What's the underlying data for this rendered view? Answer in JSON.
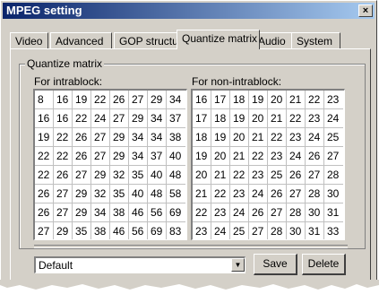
{
  "window": {
    "title": "MPEG setting",
    "close_label": "×"
  },
  "tabs": [
    {
      "label": "Video"
    },
    {
      "label": "Advanced"
    },
    {
      "label": "GOP structure"
    },
    {
      "label": "Quantize matrix",
      "active": true
    },
    {
      "label": "Audio"
    },
    {
      "label": "System"
    }
  ],
  "group": {
    "label": "Quantize matrix"
  },
  "intra": {
    "label": "For intrablock:",
    "rows": [
      [
        "8",
        "16",
        "19",
        "22",
        "26",
        "27",
        "29",
        "34"
      ],
      [
        "16",
        "16",
        "22",
        "24",
        "27",
        "29",
        "34",
        "37"
      ],
      [
        "19",
        "22",
        "26",
        "27",
        "29",
        "34",
        "34",
        "38"
      ],
      [
        "22",
        "22",
        "26",
        "27",
        "29",
        "34",
        "37",
        "40"
      ],
      [
        "22",
        "26",
        "27",
        "29",
        "32",
        "35",
        "40",
        "48"
      ],
      [
        "26",
        "27",
        "29",
        "32",
        "35",
        "40",
        "48",
        "58"
      ],
      [
        "26",
        "27",
        "29",
        "34",
        "38",
        "46",
        "56",
        "69"
      ],
      [
        "27",
        "29",
        "35",
        "38",
        "46",
        "56",
        "69",
        "83"
      ]
    ]
  },
  "nonintra": {
    "label": "For non-intrablock:",
    "rows": [
      [
        "16",
        "17",
        "18",
        "19",
        "20",
        "21",
        "22",
        "23"
      ],
      [
        "17",
        "18",
        "19",
        "20",
        "21",
        "22",
        "23",
        "24"
      ],
      [
        "18",
        "19",
        "20",
        "21",
        "22",
        "23",
        "24",
        "25"
      ],
      [
        "19",
        "20",
        "21",
        "22",
        "23",
        "24",
        "26",
        "27"
      ],
      [
        "20",
        "21",
        "22",
        "23",
        "25",
        "26",
        "27",
        "28"
      ],
      [
        "21",
        "22",
        "23",
        "24",
        "26",
        "27",
        "28",
        "30"
      ],
      [
        "22",
        "23",
        "24",
        "26",
        "27",
        "28",
        "30",
        "31"
      ],
      [
        "23",
        "24",
        "25",
        "27",
        "28",
        "30",
        "31",
        "33"
      ]
    ]
  },
  "preset": {
    "value": "Default"
  },
  "buttons": {
    "save": "Save",
    "delete": "Delete"
  }
}
